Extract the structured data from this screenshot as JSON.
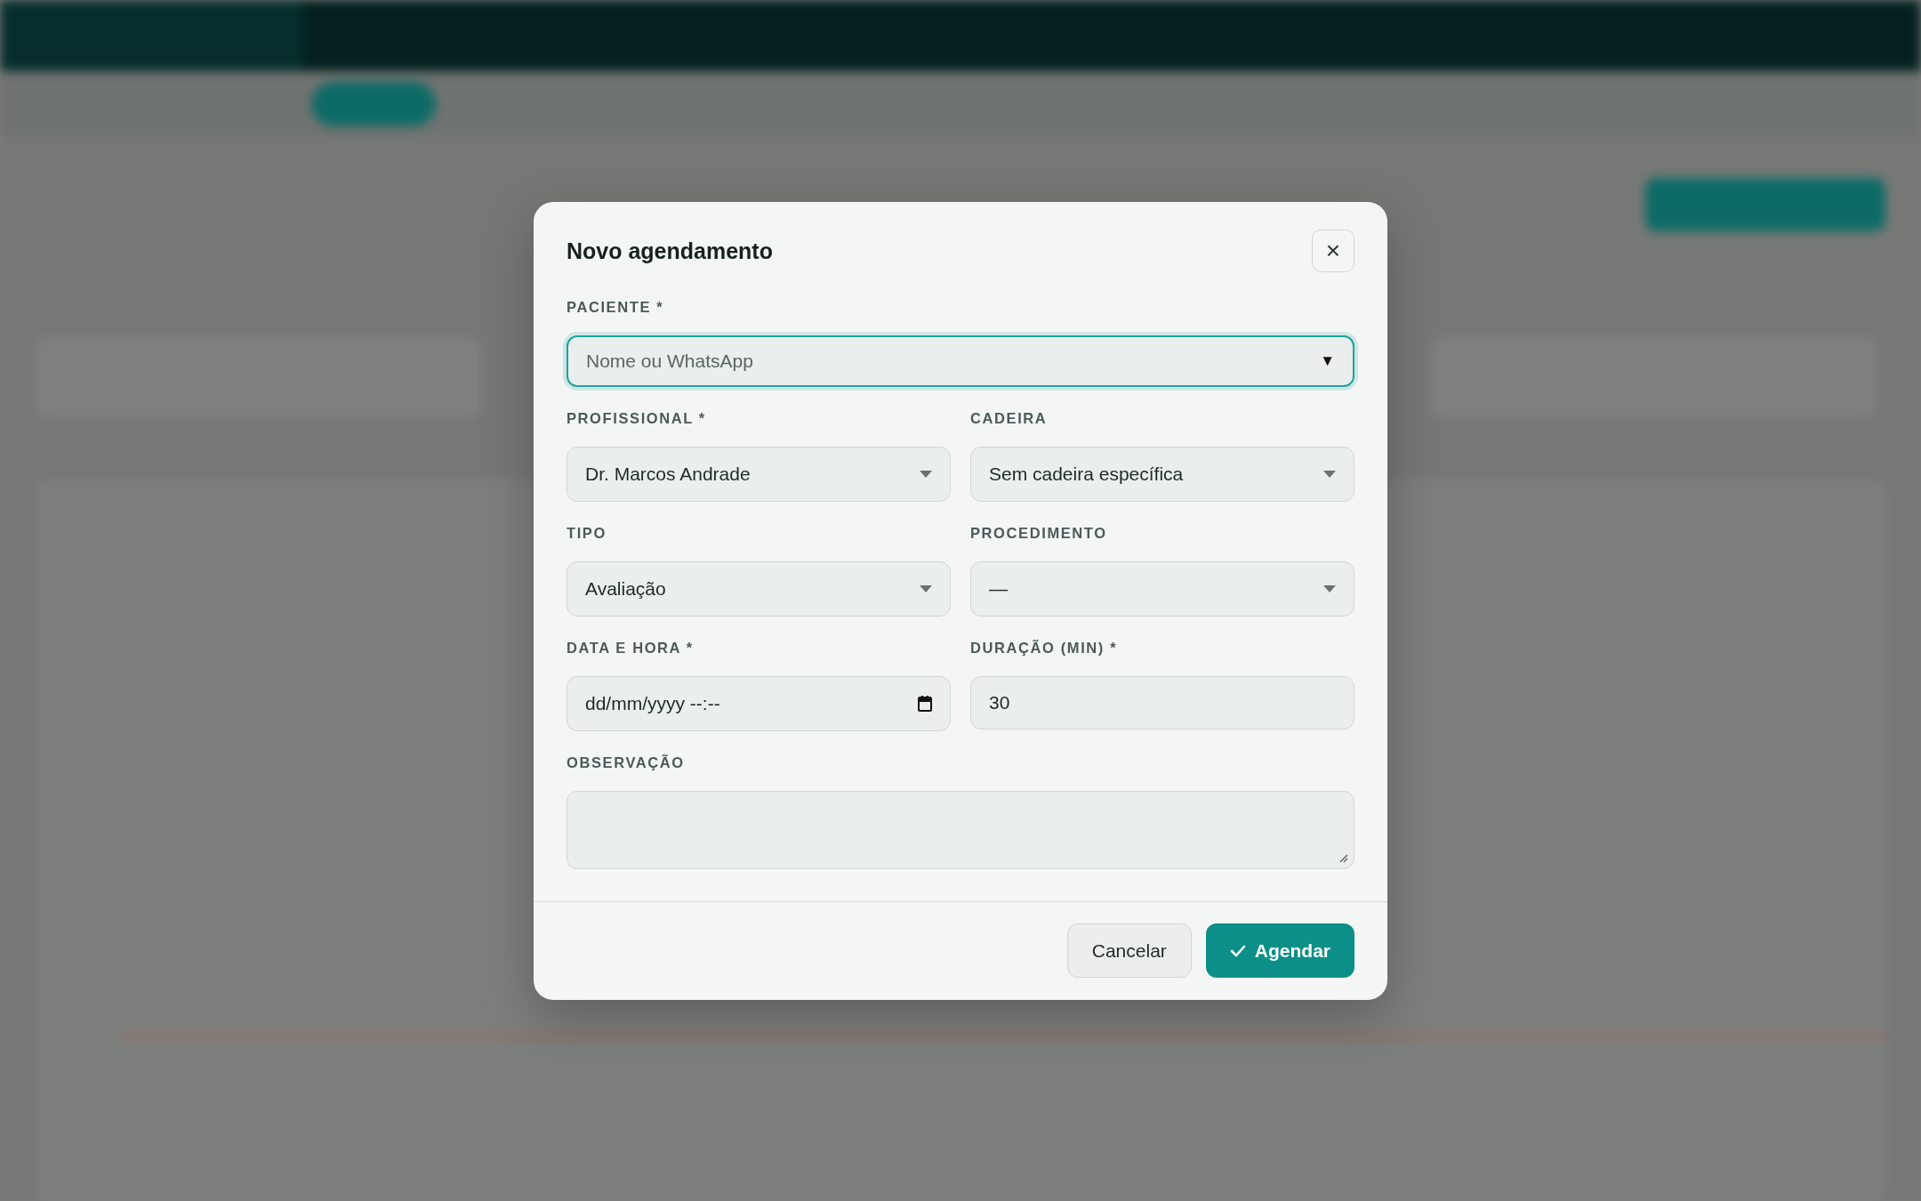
{
  "dialog": {
    "title": "Novo agendamento",
    "close": "×",
    "fields": [
      {
        "kind": "combobox",
        "label": "PACIENTE *",
        "placeholder": "Nome ou WhatsApp",
        "toggle": "▼",
        "focused": true
      },
      {
        "kind": "select",
        "label": "PROFISSIONAL *",
        "value": "Dr. Marcos Andrade",
        "focused": false
      },
      {
        "kind": "select",
        "label": "CADEIRA",
        "value": "Sem cadeira específica",
        "focused": false
      },
      {
        "kind": "select",
        "label": "TIPO",
        "value": "Avaliação",
        "focused": false
      },
      {
        "kind": "select",
        "label": "PROCEDIMENTO",
        "value": "—",
        "focused": false
      },
      {
        "kind": "datetime",
        "label": "DATA E HORA *",
        "value": "dd/mm/yyyy --:--",
        "focused": false
      },
      {
        "kind": "number",
        "label": "DURAÇÃO (MIN) *",
        "value": "30",
        "focused": false
      },
      {
        "kind": "textarea",
        "label": "OBSERVAÇÃO",
        "focused": false
      }
    ],
    "buttons": [
      {
        "kind": "secondary",
        "label": "Cancelar"
      },
      {
        "kind": "primary",
        "label": "Agendar"
      }
    ]
  }
}
